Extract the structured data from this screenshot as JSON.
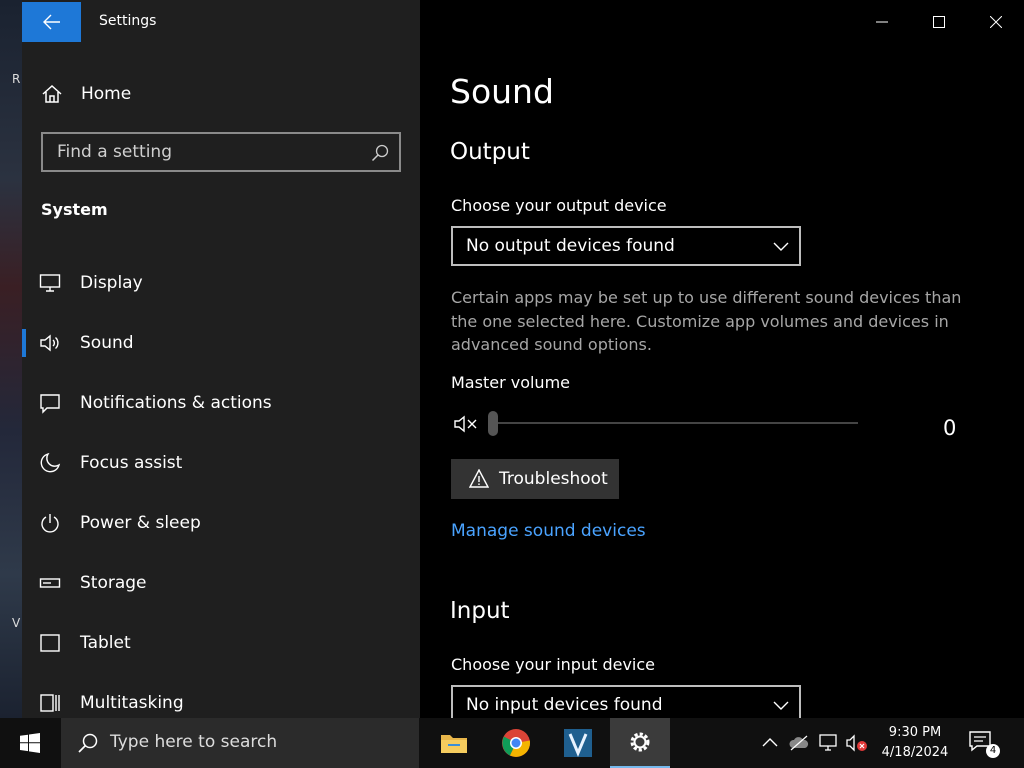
{
  "desktop": {
    "letter_r": "R",
    "letter_v": "V"
  },
  "window": {
    "title": "Settings",
    "sidebar": {
      "home_label": "Home",
      "search_placeholder": "Find a setting",
      "section_heading": "System",
      "items": [
        {
          "label": "Display",
          "icon": "monitor-icon"
        },
        {
          "label": "Sound",
          "icon": "speaker-icon",
          "selected": true
        },
        {
          "label": "Notifications & actions",
          "icon": "message-icon"
        },
        {
          "label": "Focus assist",
          "icon": "moon-icon"
        },
        {
          "label": "Power & sleep",
          "icon": "power-icon"
        },
        {
          "label": "Storage",
          "icon": "storage-icon"
        },
        {
          "label": "Tablet",
          "icon": "tablet-icon"
        },
        {
          "label": "Multitasking",
          "icon": "multitasking-icon"
        }
      ]
    },
    "content": {
      "page_title": "Sound",
      "output": {
        "heading": "Output",
        "device_label": "Choose your output device",
        "device_value": "No output devices found",
        "description": "Certain apps may be set up to use different sound devices than the one selected here. Customize app volumes and devices in advanced sound options.",
        "volume_label": "Master volume",
        "volume_value": "0",
        "troubleshoot_label": "Troubleshoot",
        "manage_link": "Manage sound devices"
      },
      "input": {
        "heading": "Input",
        "device_label": "Choose your input device",
        "device_value": "No input devices found"
      }
    }
  },
  "taskbar": {
    "search_text": "Type here to search",
    "time": "9:30 PM",
    "date": "4/18/2024",
    "notification_count": "4",
    "colors": {
      "accent": "#1e78d7",
      "link": "#4aa3ff"
    }
  }
}
